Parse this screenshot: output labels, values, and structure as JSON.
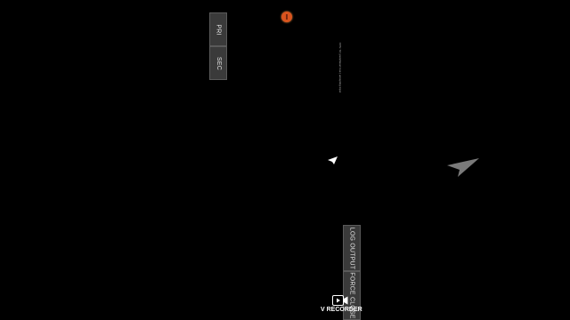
{
  "buttons": {
    "pri": "PRI",
    "sec": "SEC",
    "log_output": "LOG OUTPUT",
    "force_close": "FORCE CLOSE"
  },
  "status_text": "FPS: 72 | peripheral: true | accepting input",
  "watermark": {
    "label": "V RECORDER",
    "icon": "video-recorder-icon"
  },
  "icons": {
    "badge": "shield-badge-icon",
    "cursor_small": "cursor-arrow-icon",
    "cursor_large": "large-arrow-pointer-icon"
  },
  "colors": {
    "background": "#000000",
    "button_bg": "#3a3a3a",
    "button_border": "#5a5a5a",
    "badge": "#d9541e",
    "pointer": "#7a7a7a"
  }
}
